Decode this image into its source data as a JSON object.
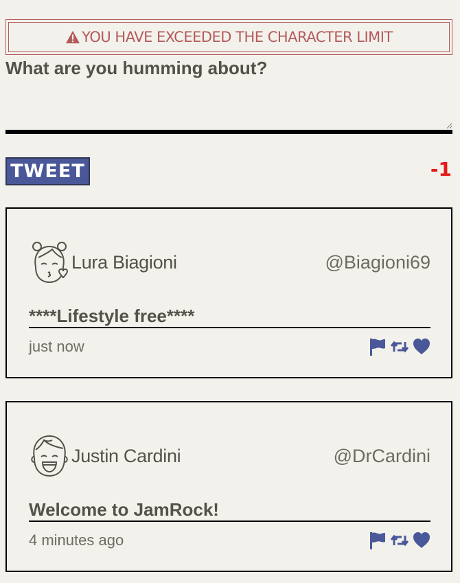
{
  "error": {
    "message": "YOU HAVE EXCEEDED THE CHARACTER LIMIT",
    "icon": "warning-triangle-icon",
    "color": "#b45a5a"
  },
  "compose": {
    "prompt": "What are you humming about?",
    "value": "",
    "button_label": "TWEET",
    "counter": "-1"
  },
  "colors": {
    "accent": "#4a5899",
    "counter": "#e61919",
    "background": "#f3f1ec",
    "text": "#545149"
  },
  "tweets": [
    {
      "name": "Lura Biagioni",
      "handle": "@Biagioni69",
      "avatar": "girl-kiss-avatar-icon",
      "text": "****Lifestyle free****",
      "time": "just now",
      "actions": [
        "flag-icon",
        "retweet-icon",
        "heart-icon"
      ]
    },
    {
      "name": "Justin Cardini",
      "handle": "@DrCardini",
      "avatar": "boy-laughing-avatar-icon",
      "text": "Welcome to JamRock!",
      "time": "4 minutes ago",
      "actions": [
        "flag-icon",
        "retweet-icon",
        "heart-icon"
      ]
    }
  ]
}
